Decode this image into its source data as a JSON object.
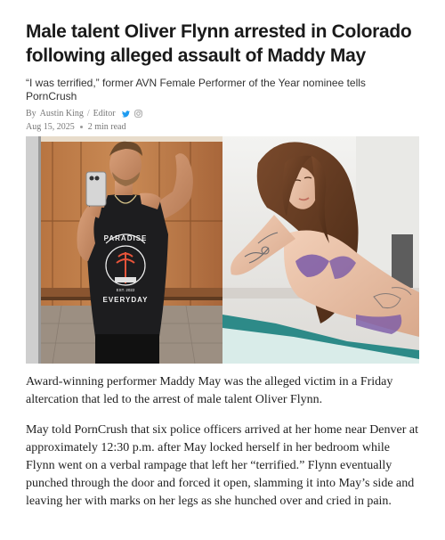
{
  "article": {
    "headline": "Male talent Oliver Flynn arrested in Colorado following alleged assault of Maddy May",
    "dek": "“I was terrified,” former AVN Female Performer of the Year nominee tells PornCrush",
    "byline": {
      "prefix": "By",
      "author": "Austin King",
      "separator": "/",
      "role": "Editor",
      "social_icons": [
        "twitter-icon",
        "instagram-icon"
      ]
    },
    "date": "Aug 15, 2025",
    "read_time": "2 min read",
    "hero": {
      "left_photo": {
        "shirt_text_top": "PARADISE",
        "shirt_text_est": "EST. 2022",
        "shirt_text_bottom": "EVERYDAY"
      },
      "right_photo": {}
    },
    "paragraphs": [
      "Award-winning performer Maddy May was the alleged victim in a Friday altercation that led to the arrest of male talent Oliver Flynn.",
      "May told PornCrush that six police officers arrived at her home near Denver at approximately 12:30 p.m. after May locked herself in her bedroom while Flynn went on a verbal rampage that left her “terrified.” Flynn eventually punched through the door and forced it open, slamming it into May’s side and leaving her with marks on her legs as she hunched over and cried in pain."
    ]
  },
  "colors": {
    "headline": "#1a1a1a",
    "meta": "#777777",
    "twitter": "#1d9bf0"
  }
}
